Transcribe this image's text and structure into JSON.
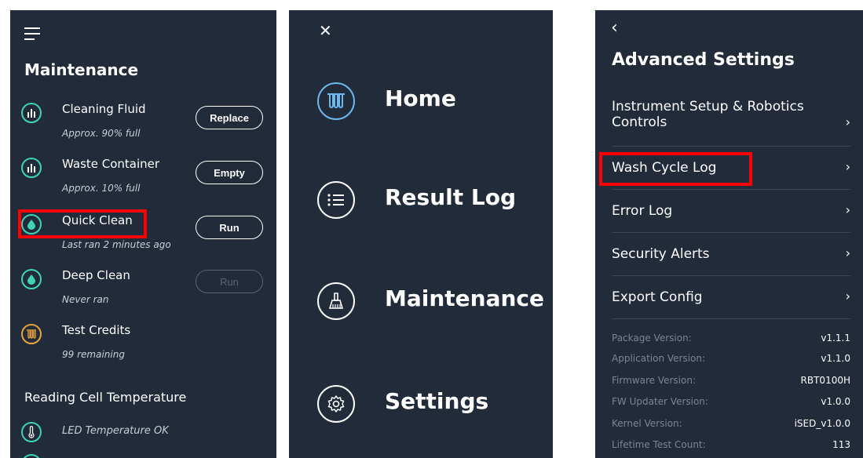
{
  "maintenance": {
    "menu_icon": "hamburger-icon",
    "title": "Maintenance",
    "items": [
      {
        "name": "Cleaning Fluid",
        "sub": "Approx. 90% full",
        "icon": "level-bars-icon",
        "action": "Replace",
        "action_enabled": true
      },
      {
        "name": "Waste Container",
        "sub": "Approx. 10% full",
        "icon": "level-bars-icon",
        "action": "Empty",
        "action_enabled": true
      },
      {
        "name": "Quick Clean",
        "sub": "Last ran 2 minutes ago",
        "icon": "droplet-icon",
        "action": "Run",
        "action_enabled": true
      },
      {
        "name": "Deep Clean",
        "sub": "Never ran",
        "icon": "droplet-icon",
        "action": "Run",
        "action_enabled": false
      },
      {
        "name": "Test Credits",
        "sub": "99 remaining",
        "icon": "test-tubes-icon"
      }
    ],
    "section_title": "Reading Cell Temperature",
    "temp_status": "LED Temperature OK",
    "highlight_item": "Quick Clean"
  },
  "nav_menu": {
    "close_icon": "close-icon",
    "items": [
      {
        "label": "Home",
        "icon": "test-tubes-icon",
        "active": true
      },
      {
        "label": "Result Log",
        "icon": "list-icon",
        "active": false
      },
      {
        "label": "Maintenance",
        "icon": "broom-icon",
        "active": false
      },
      {
        "label": "Settings",
        "icon": "gear-icon",
        "active": false
      }
    ]
  },
  "advanced": {
    "back_icon": "chevron-left-icon",
    "title": "Advanced Settings",
    "items": [
      {
        "label": "Instrument Setup & Robotics Controls"
      },
      {
        "label": "Wash Cycle Log"
      },
      {
        "label": "Error Log"
      },
      {
        "label": "Security Alerts"
      },
      {
        "label": "Export Config"
      }
    ],
    "highlight_item": "Wash Cycle Log",
    "versions": [
      {
        "key": "Package Version:",
        "value": "v1.1.1"
      },
      {
        "key": "Application Version:",
        "value": "v1.1.0"
      },
      {
        "key": "Firmware Version:",
        "value": "RBT0100H"
      },
      {
        "key": "FW Updater Version:",
        "value": "v1.0.0"
      },
      {
        "key": "Kernel Version:",
        "value": "iSED_v1.0.0"
      },
      {
        "key": "Lifetime Test Count:",
        "value": "113"
      }
    ]
  },
  "colors": {
    "panel_bg": "#222b3a",
    "teal": "#3ed3b4",
    "gold": "#e8a43a",
    "active_blue": "#6ab8ef",
    "highlight": "#ff0000"
  }
}
